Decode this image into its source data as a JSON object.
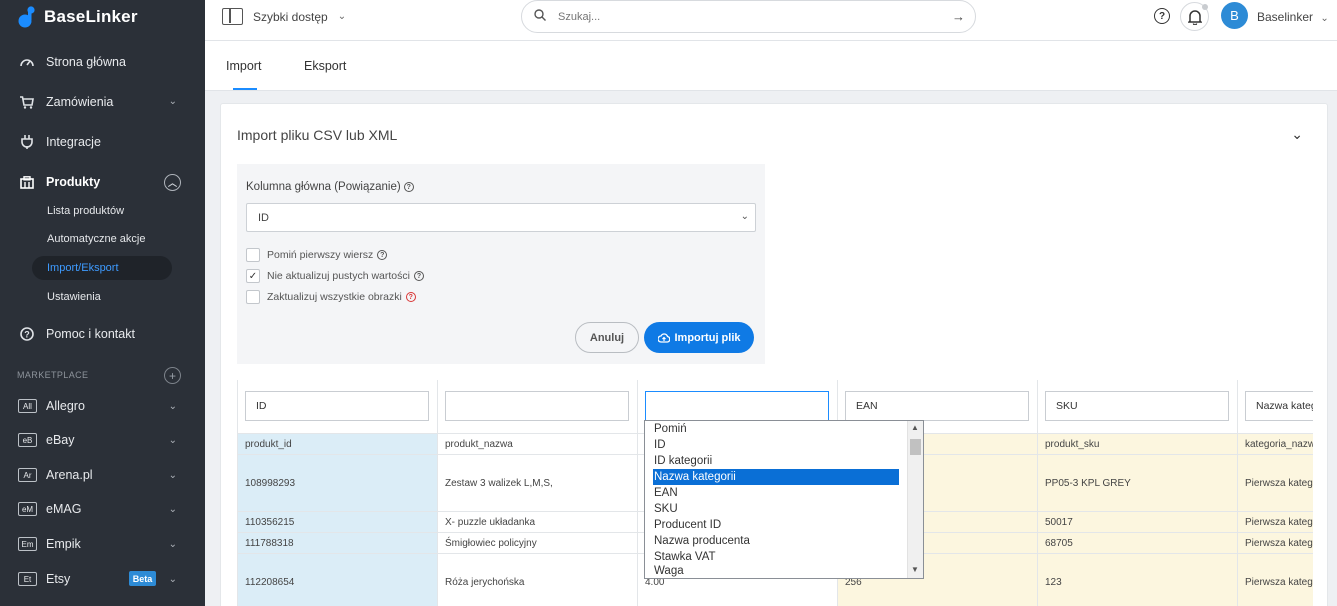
{
  "brand": {
    "name": "BaseLinker"
  },
  "sidebar": {
    "items": [
      {
        "label": "Strona główna",
        "icon": "dashboard-icon"
      },
      {
        "label": "Zamówienia",
        "icon": "cart-icon"
      },
      {
        "label": "Integracje",
        "icon": "plug-icon"
      },
      {
        "label": "Produkty",
        "icon": "box-icon"
      },
      {
        "label": "Pomoc i kontakt",
        "icon": "help-icon"
      }
    ],
    "sub_items": [
      {
        "label": "Lista produktów"
      },
      {
        "label": "Automatyczne akcje"
      },
      {
        "label": "Import/Eksport"
      },
      {
        "label": "Ustawienia"
      }
    ],
    "section_label": "MARKETPLACE",
    "marketplaces": [
      {
        "badge": "All",
        "label": "Allegro"
      },
      {
        "badge": "eB",
        "label": "eBay"
      },
      {
        "badge": "Ar",
        "label": "Arena.pl"
      },
      {
        "badge": "eM",
        "label": "eMAG"
      },
      {
        "badge": "Em",
        "label": "Empik"
      },
      {
        "badge": "Et",
        "label": "Etsy",
        "tag": "Beta"
      }
    ]
  },
  "topbar": {
    "quick_access": "Szybki dostęp",
    "search_placeholder": "Szukaj...",
    "avatar_letter": "B",
    "user_name": "Baselinker"
  },
  "tabs": [
    {
      "label": "Import",
      "active": true
    },
    {
      "label": "Eksport",
      "active": false
    }
  ],
  "card": {
    "title": "Import pliku CSV lub XML",
    "main_column_label": "Kolumna główna (Powiązanie)",
    "main_column_value": "ID",
    "options": [
      {
        "label": "Pomiń pierwszy wiersz",
        "checked": false
      },
      {
        "label": "Nie aktualizuj pustych wartości",
        "checked": true
      },
      {
        "label": "Zaktualizuj wszystkie obrazki",
        "checked": false
      }
    ],
    "cancel_label": "Anuluj",
    "import_label": "Importuj plik"
  },
  "mapping": {
    "columns": [
      {
        "field": "ID",
        "header": "produkt_id",
        "cells": [
          "108998293",
          "110356215",
          "111788318",
          "112208654"
        ]
      },
      {
        "field": "",
        "header": "produkt_nazwa",
        "cells": [
          "Zestaw 3 walizek L,M,S,",
          "X- puzzle układanka",
          "Śmigłowiec policyjny",
          "Róża jerychońska"
        ]
      },
      {
        "field": "",
        "header": "",
        "cells": [
          "",
          "",
          "",
          "4.00"
        ]
      },
      {
        "field": "EAN",
        "header": "",
        "cells": [
          "",
          "",
          "",
          "256"
        ]
      },
      {
        "field": "SKU",
        "header": "produkt_sku",
        "cells": [
          "PP05-3 KPL GREY",
          "50017",
          "68705",
          "123"
        ]
      },
      {
        "field": "Nazwa kategorii",
        "header": "kategoria_nazwa",
        "cells": [
          "Pierwsza kategoria",
          "Pierwsza kategoria",
          "Pierwsza kategoria",
          "Pierwsza kategoria"
        ]
      }
    ],
    "dropdown_options": [
      "Pomiń",
      "ID",
      "ID kategorii",
      "Nazwa kategorii",
      "EAN",
      "SKU",
      "Producent ID",
      "Nazwa producenta",
      "Stawka VAT",
      "Waga"
    ],
    "dropdown_selected": "Nazwa kategorii"
  },
  "colors": {
    "sidebar_bg": "#2b3038",
    "accent": "#1b8cff",
    "cell_blue": "#dbedf7",
    "cell_yellow": "#fcf6df"
  }
}
